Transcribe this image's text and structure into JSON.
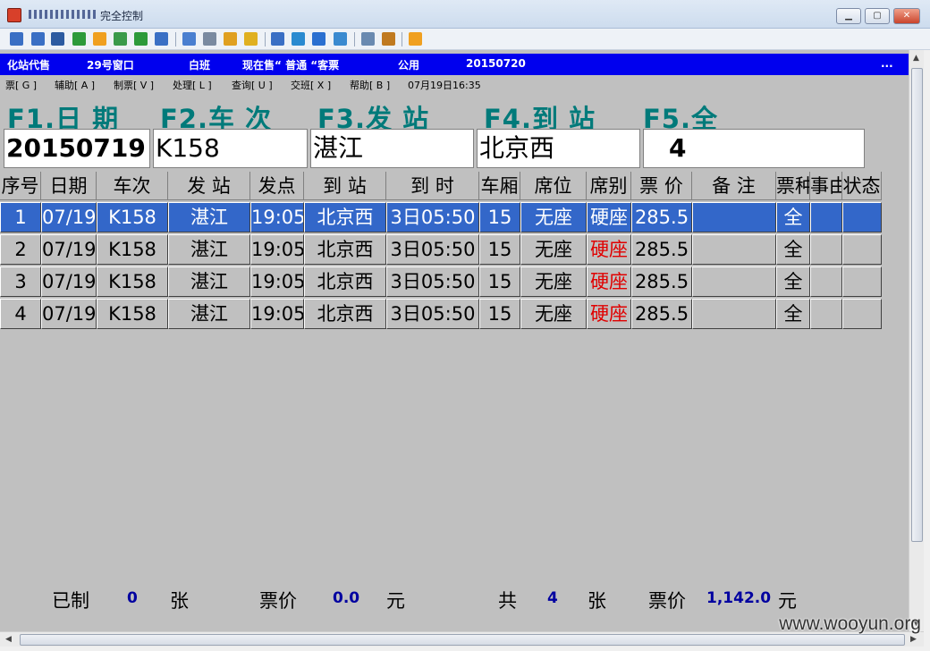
{
  "window": {
    "title": "完全控制",
    "minimize": "▁",
    "maximize": "▢",
    "close": "✕"
  },
  "toolbar": {
    "icons": [
      "computer-icon",
      "monitor-icon",
      "terminal-icon",
      "transfer-icon",
      "power-icon",
      "chat-icon",
      "phone-icon",
      "message-icon",
      "upload-icon",
      "network-icon",
      "lock-icon",
      "unlock-icon",
      "window-icon",
      "fit-icon",
      "fullscreen-icon",
      "refresh-icon",
      "copy-icon",
      "tools-icon",
      "exit-icon"
    ],
    "colors": [
      "#3a6fc4",
      "#3a6fc4",
      "#2c5aa0",
      "#2d9a3a",
      "#f0a020",
      "#3a9a4a",
      "#2d9a3a",
      "#3a6fc4",
      "#4a7fd0",
      "#7a8aa0",
      "#e0a020",
      "#e0b020",
      "#3a6fc4",
      "#2a8ad0",
      "#2a6fd0",
      "#3a8ad0",
      "#6a8ab0",
      "#c07a20",
      "#f0a020"
    ]
  },
  "infobar": {
    "station": "化站代售",
    "window": "29号窗口",
    "shift": "白班",
    "selling": "现在售“ 普通  “客票",
    "usage": "公用",
    "date": "20150720",
    "more": "..."
  },
  "menubar": {
    "items": [
      "票[ G ]",
      "辅助[ A ]",
      "制票[ V ]",
      "处理[ L ]",
      "查询[ U ]",
      "交班[ X ]",
      "帮助[ B ]"
    ],
    "timestamp": "07月19日16:35"
  },
  "fields": {
    "f1_label": "F1.日 期",
    "f1_value": "20150719",
    "f2_label": "F2.车 次",
    "f2_value": "K158",
    "f3_label": "F3.发 站",
    "f3_value": "湛江",
    "f4_label": "F4.到 站",
    "f4_value": "北京西",
    "f5_label": "F5.全",
    "f5_value": "4"
  },
  "table": {
    "headers": [
      "序号",
      "日期",
      "车次",
      "发 站",
      "发点",
      "到 站",
      "到 时",
      "车厢",
      "席位",
      "席别",
      "票 价",
      "备 注",
      "票种",
      "事由",
      "状态"
    ],
    "rows": [
      [
        "1",
        "07/19",
        "K158",
        "湛江",
        "19:05",
        "北京西",
        "3日05:50",
        "15",
        "无座",
        "硬座",
        "285.5",
        "",
        "全",
        "",
        ""
      ],
      [
        "2",
        "07/19",
        "K158",
        "湛江",
        "19:05",
        "北京西",
        "3日05:50",
        "15",
        "无座",
        "硬座",
        "285.5",
        "",
        "全",
        "",
        ""
      ],
      [
        "3",
        "07/19",
        "K158",
        "湛江",
        "19:05",
        "北京西",
        "3日05:50",
        "15",
        "无座",
        "硬座",
        "285.5",
        "",
        "全",
        "",
        ""
      ],
      [
        "4",
        "07/19",
        "K158",
        "湛江",
        "19:05",
        "北京西",
        "3日05:50",
        "15",
        "无座",
        "硬座",
        "285.5",
        "",
        "全",
        "",
        ""
      ]
    ],
    "selected_row": 1
  },
  "footer": {
    "made_label": "已制",
    "made_count": "0",
    "unit_zhang": "张",
    "price_label": "票价",
    "price_value": "0.0",
    "unit_yuan": "元",
    "total_label": "共",
    "total_count": "4",
    "unit_zhang2": "张",
    "total_price_label": "票价",
    "total_price_value": "1,142.0",
    "unit_yuan2": "元"
  },
  "watermark": "www.wooyun.org"
}
